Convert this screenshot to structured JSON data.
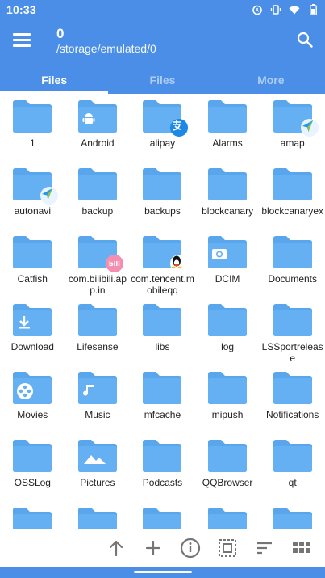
{
  "status_bar": {
    "time": "10:33",
    "icons": [
      "alarm-icon",
      "vibrate-icon",
      "wifi-icon",
      "battery-icon"
    ]
  },
  "app_bar": {
    "title": "0",
    "path": "/storage/emulated/0"
  },
  "tabs": [
    {
      "label": "Files",
      "active": true
    },
    {
      "label": "Files",
      "active": false
    },
    {
      "label": "More",
      "active": false
    }
  ],
  "folders": [
    {
      "name": "1"
    },
    {
      "name": "Android",
      "inner": "android"
    },
    {
      "name": "alipay",
      "badge": "alipay"
    },
    {
      "name": "Alarms"
    },
    {
      "name": "amap",
      "badge": "amap"
    },
    {
      "name": "autonavi",
      "badge": "amap"
    },
    {
      "name": "backup"
    },
    {
      "name": "backups"
    },
    {
      "name": "blockcanary"
    },
    {
      "name": "blockcanaryex"
    },
    {
      "name": "Catfish"
    },
    {
      "name": "com.bilibili.app.in",
      "badge": "bilibili"
    },
    {
      "name": "com.tencent.mobileqq",
      "badge": "qq"
    },
    {
      "name": "DCIM",
      "inner": "camera"
    },
    {
      "name": "Documents"
    },
    {
      "name": "Download",
      "inner": "download"
    },
    {
      "name": "Lifesense"
    },
    {
      "name": "libs"
    },
    {
      "name": "log"
    },
    {
      "name": "LSSportrelease"
    },
    {
      "name": "Movies",
      "inner": "movie"
    },
    {
      "name": "Music",
      "inner": "music"
    },
    {
      "name": "mfcache"
    },
    {
      "name": "mipush"
    },
    {
      "name": "Notifications"
    },
    {
      "name": "OSSLog"
    },
    {
      "name": "Pictures",
      "inner": "pictures"
    },
    {
      "name": "Podcasts"
    },
    {
      "name": "QQBrowser"
    },
    {
      "name": "qt"
    },
    {
      "name": ""
    },
    {
      "name": ""
    },
    {
      "name": ""
    },
    {
      "name": ""
    },
    {
      "name": ""
    }
  ],
  "colors": {
    "primary": "#4a8ee8",
    "folder": "#64b0f2",
    "folder_tab": "#5aa6ec"
  },
  "bottom_actions": [
    "up-arrow-icon",
    "add-icon",
    "info-icon",
    "select-icon",
    "sort-icon",
    "grid-view-icon"
  ]
}
